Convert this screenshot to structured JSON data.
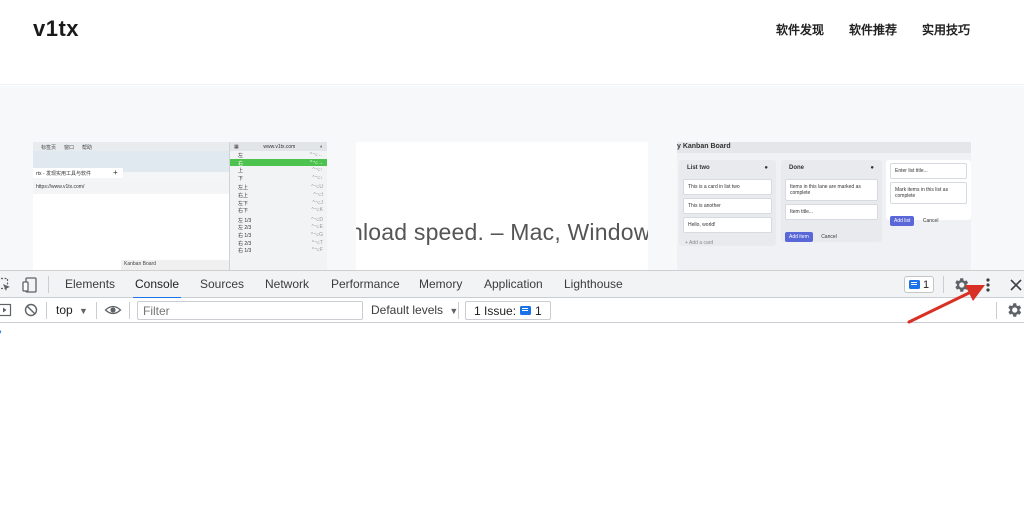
{
  "site": {
    "logo": "v1tx",
    "nav": [
      "软件发现",
      "软件推荐",
      "实用技巧"
    ]
  },
  "thumb1": {
    "menubar": [
      "标签页",
      "窗口",
      "帮助"
    ],
    "menu_url": "www.v1tx.com",
    "tab_title": "rtx - 发现实用工具与软件",
    "address": "https://www.v1tx.com/",
    "inner_label": "Kanban Board",
    "menu_items": [
      {
        "label": "左",
        "key": "^⌥←",
        "selected": false
      },
      {
        "label": "右",
        "key": "^⌥→",
        "selected": true
      },
      {
        "label": "上",
        "key": "^⌥↑",
        "selected": false
      },
      {
        "label": "下",
        "key": "^⌥↓",
        "selected": false
      },
      {
        "label": "左上",
        "key": "^⌥U",
        "selected": false
      },
      {
        "label": "右上",
        "key": "^⌥I",
        "selected": false
      },
      {
        "label": "左下",
        "key": "^⌥J",
        "selected": false
      },
      {
        "label": "右下",
        "key": "^⌥K",
        "selected": false
      },
      {
        "label": "左 1/3",
        "key": "^⌥D",
        "selected": false
      },
      {
        "label": "左 2/3",
        "key": "^⌥E",
        "selected": false
      },
      {
        "label": "右 1/3",
        "key": "^⌥G",
        "selected": false
      },
      {
        "label": "右 2/3",
        "key": "^⌥T",
        "selected": false
      },
      {
        "label": "右 1/3",
        "key": "^⌥F",
        "selected": false
      }
    ]
  },
  "thumb2": {
    "text": "nload speed. – Mac, Window"
  },
  "thumb3": {
    "title": "y Kanban Board",
    "lanes": [
      {
        "name": "List two",
        "cards": [
          "This is a card in list two",
          "This is another",
          "Hello, world!"
        ],
        "add_label": "+ Add a card"
      },
      {
        "name": "Done",
        "cards": [
          "Items in this lane are marked as complete"
        ],
        "input_placeholder": "Item title...",
        "add_button": "Add item",
        "cancel": "Cancel"
      },
      {
        "input_placeholder": "Enter list title...",
        "cards": [
          "Mark items in this list as complete"
        ],
        "add_button": "Add list",
        "cancel": "Cancel"
      }
    ]
  },
  "devtools": {
    "tabs": [
      "Elements",
      "Console",
      "Sources",
      "Network",
      "Performance",
      "Memory",
      "Application",
      "Lighthouse"
    ],
    "active_tab": "Console",
    "issues_badge_count": "1",
    "context": "top",
    "filter_placeholder": "Filter",
    "levels": "Default levels",
    "issues_label": "1 Issue:",
    "issues_count": "1",
    "prompt": "›"
  },
  "colors": {
    "accent": "#1a73e8",
    "arrow": "#d93025",
    "menu_selected": "#4cc24f"
  }
}
